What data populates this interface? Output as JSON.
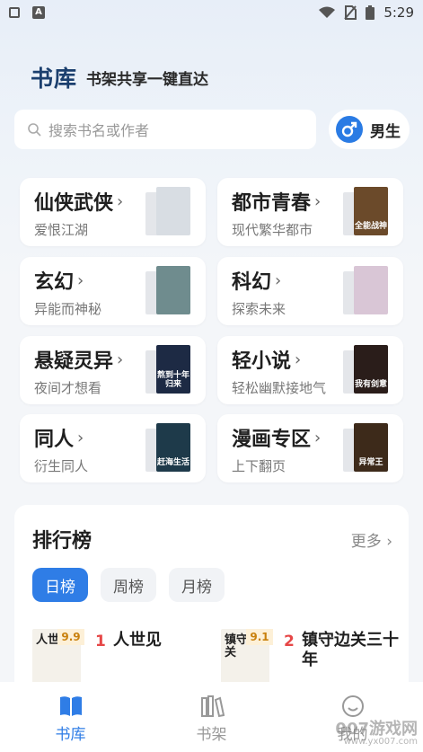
{
  "status_bar": {
    "time": "5:29"
  },
  "header": {
    "brand": "书库",
    "slogan": "书架共享一键直达"
  },
  "search": {
    "placeholder": "搜索书名或作者"
  },
  "gender": {
    "label": "男生"
  },
  "categories": [
    {
      "title": "仙侠武侠",
      "subtitle": "爱恨江湖",
      "cover_color": "#d8dde3",
      "cover_text": ""
    },
    {
      "title": "都市青春",
      "subtitle": "现代繁华都市",
      "cover_color": "#6b4a2a",
      "cover_text": "全能战神"
    },
    {
      "title": "玄幻",
      "subtitle": "异能而神秘",
      "cover_color": "#6f8c8e",
      "cover_text": ""
    },
    {
      "title": "科幻",
      "subtitle": "探索未来",
      "cover_color": "#d9c6d6",
      "cover_text": ""
    },
    {
      "title": "悬疑灵异",
      "subtitle": "夜间才想看",
      "cover_color": "#1d2a44",
      "cover_text": "熬到十年归来"
    },
    {
      "title": "轻小说",
      "subtitle": "轻松幽默接地气",
      "cover_color": "#2a1d1a",
      "cover_text": "我有剑意"
    },
    {
      "title": "同人",
      "subtitle": "衍生同人",
      "cover_color": "#1e3a4a",
      "cover_text": "赶海生活"
    },
    {
      "title": "漫画专区",
      "subtitle": "上下翻页",
      "cover_color": "#3d2a1a",
      "cover_text": "异常王"
    }
  ],
  "ranking": {
    "title": "排行榜",
    "more": "更多",
    "tabs": [
      "日榜",
      "周榜",
      "月榜"
    ],
    "active_tab": 0,
    "books": [
      {
        "rank": "1",
        "name": "人世见",
        "score": "9.9",
        "cover_text": "人世见"
      },
      {
        "rank": "2",
        "name": "镇守边关三十年",
        "score": "9.1",
        "cover_text": "镇守边关"
      }
    ]
  },
  "tab_bar": {
    "items": [
      {
        "label": "书库",
        "icon": "book-open-icon",
        "active": true
      },
      {
        "label": "书架",
        "icon": "bookshelf-icon",
        "active": false
      },
      {
        "label": "我的",
        "icon": "profile-icon",
        "active": false
      }
    ]
  },
  "watermark": {
    "text": "007游戏网",
    "sub": "www.yx007.com"
  },
  "colors": {
    "accent": "#2f7de6",
    "rank_red": "#e64747",
    "brand": "#1b3f6e"
  }
}
